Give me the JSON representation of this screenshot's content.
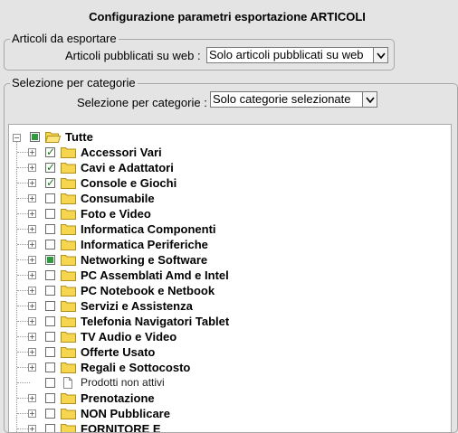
{
  "title": "Configurazione parametri esportazione ARTICOLI",
  "section_articoli": {
    "legend": "Articoli da esportare",
    "label": "Articoli pubblicati su web :",
    "select_value": "Solo articoli pubblicati su web"
  },
  "section_categorie": {
    "legend": "Selezione per categorie",
    "label": "Selezione per categorie :",
    "select_value": "Solo categorie selezionate"
  },
  "tree": {
    "root": {
      "label": "Tutte",
      "state": "partial",
      "expander": "−"
    },
    "items": [
      {
        "label": "Accessori Vari",
        "state": "checked",
        "type": "folder"
      },
      {
        "label": "Cavi e Adattatori",
        "state": "checked",
        "type": "folder"
      },
      {
        "label": "Console e Giochi",
        "state": "checked",
        "type": "folder"
      },
      {
        "label": "Consumabile",
        "state": "unchecked",
        "type": "folder"
      },
      {
        "label": "Foto e Video",
        "state": "unchecked",
        "type": "folder"
      },
      {
        "label": "Informatica Componenti",
        "state": "unchecked",
        "type": "folder"
      },
      {
        "label": "Informatica Periferiche",
        "state": "unchecked",
        "type": "folder"
      },
      {
        "label": "Networking e Software",
        "state": "partial",
        "type": "folder"
      },
      {
        "label": "PC Assemblati Amd e Intel",
        "state": "unchecked",
        "type": "folder"
      },
      {
        "label": "PC Notebook e Netbook",
        "state": "unchecked",
        "type": "folder"
      },
      {
        "label": "Servizi e Assistenza",
        "state": "unchecked",
        "type": "folder"
      },
      {
        "label": "Telefonia Navigatori Tablet",
        "state": "unchecked",
        "type": "folder"
      },
      {
        "label": "TV Audio e Video",
        "state": "unchecked",
        "type": "folder"
      },
      {
        "label": "Offerte Usato",
        "state": "unchecked",
        "type": "folder"
      },
      {
        "label": "Regali e Sottocosto",
        "state": "unchecked",
        "type": "folder"
      },
      {
        "label": "Prodotti non attivi",
        "state": "unchecked",
        "type": "doc"
      },
      {
        "label": "Prenotazione",
        "state": "unchecked",
        "type": "folder"
      },
      {
        "label": "NON Pubblicare",
        "state": "unchecked",
        "type": "folder"
      },
      {
        "label": "FORNITORE E",
        "state": "unchecked",
        "type": "folder"
      }
    ]
  },
  "colors": {
    "background": "#e4e4e4",
    "folder": "#f5d64e",
    "check": "#1a7a1a",
    "partial": "#2f9a3f"
  }
}
